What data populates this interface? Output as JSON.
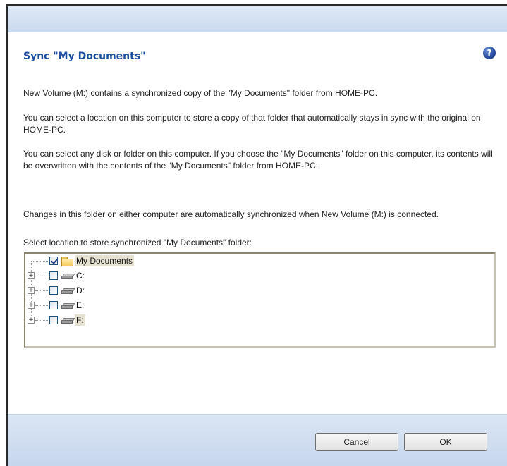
{
  "dialog": {
    "title": "Sync \"My Documents\"",
    "help_icon": "?",
    "paragraphs": [
      "New Volume (M:) contains a synchronized copy of the \"My Documents\" folder from HOME-PC.",
      "You can select a location on this computer to store a copy of that folder that automatically stays in sync with the original on HOME-PC.",
      "You can select any disk or folder on this computer. If you choose the \"My Documents\" folder on this computer, its contents will be overwritten with the contents of the \"My Documents\" folder from HOME-PC.",
      "Changes in this folder on either computer are automatically synchronized when New Volume (M:) is connected.",
      "Select location to store synchronized \"My Documents\" folder:"
    ],
    "tree": {
      "items": [
        {
          "label": "My Documents",
          "checked": true,
          "icon": "folder-icon",
          "expandable": false
        },
        {
          "label": "C:",
          "checked": false,
          "icon": "drive-icon",
          "expandable": true
        },
        {
          "label": "D:",
          "checked": false,
          "icon": "drive-icon",
          "expandable": true
        },
        {
          "label": "E:",
          "checked": false,
          "icon": "drive-icon",
          "expandable": true
        },
        {
          "label": "F:",
          "checked": false,
          "icon": "drive-icon",
          "expandable": true
        }
      ],
      "expander_symbol": "+"
    },
    "buttons": {
      "cancel_label": "Cancel",
      "ok_label": "OK"
    },
    "colors": {
      "title": "#1c4fa0",
      "band": "#c9d9ee"
    }
  }
}
